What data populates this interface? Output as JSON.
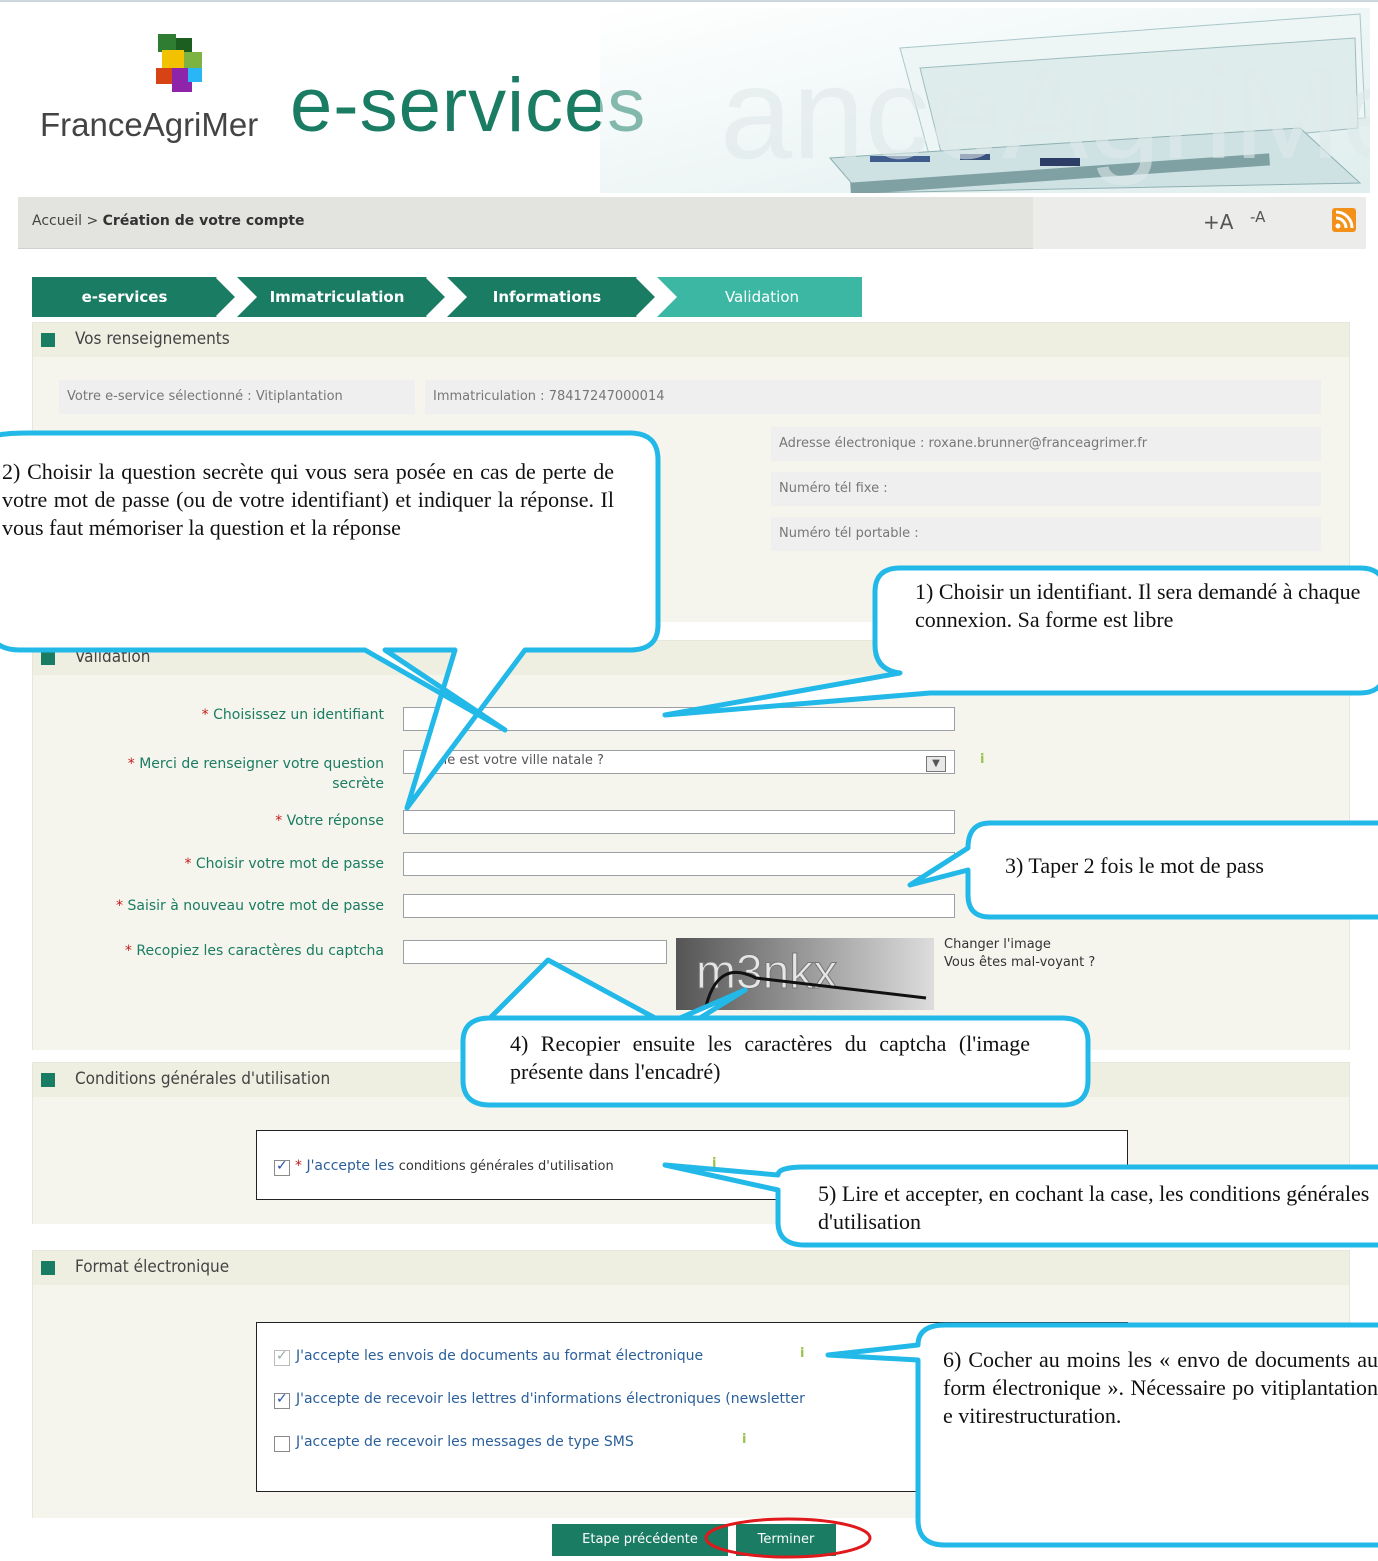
{
  "header": {
    "logo_text": "FranceAgriMer",
    "title": "e-services"
  },
  "breadcrumb": {
    "home": "Accueil",
    "separator": " > ",
    "current": "Création de votre compte",
    "font_plus": "+A",
    "font_minus": "-A",
    "rss_icon": "rss-icon"
  },
  "steps": [
    "e-services",
    "Immatriculation",
    "Informations",
    "Validation"
  ],
  "renseignements": {
    "title": "Vos renseignements",
    "service": "Votre e-service sélectionné : Vitiplantation",
    "immatriculation": "Immatriculation : 78417247000014",
    "email": "Adresse électronique : roxane.brunner@franceagrimer.fr",
    "tel_fixe": "Numéro tél fixe :",
    "tel_portable": "Numéro tél portable :"
  },
  "validation": {
    "title": "Validation",
    "required_mark": "*",
    "identifiant_label": "Choisissez un identifiant",
    "question_label_1": "Merci de renseigner votre question",
    "question_label_2": "secrète",
    "question_value": "elle est votre ville natale ?",
    "reponse_label": "Votre réponse",
    "password_label": "Choisir votre mot de passe",
    "password_confirm_label": "Saisir à nouveau votre mot de passe",
    "captcha_label": "Recopiez les caractères du captcha",
    "captcha_text": "m3nkx",
    "change_image": "Changer l'image",
    "visually_impaired": "Vous êtes mal-voyant ?"
  },
  "cgu": {
    "title": "Conditions générales d'utilisation",
    "accept_prefix": "J'accepte les ",
    "accept_link": "conditions générales d'utilisation",
    "checked": true
  },
  "format": {
    "title": "Format électronique",
    "options": [
      {
        "label": "J'accepte les envois de documents au format électronique",
        "checked": true,
        "disabled": true
      },
      {
        "label": "J'accepte de recevoir les lettres d'informations électroniques (newsletter",
        "checked": true,
        "disabled": false
      },
      {
        "label": "J'accepte de recevoir les messages de type SMS",
        "checked": false,
        "disabled": false
      }
    ]
  },
  "buttons": {
    "previous": "Etape précédente",
    "finish": "Terminer"
  },
  "callouts": {
    "c1": "1) Choisir un identifiant. Il sera demandé à chaque connexion. Sa forme est libre",
    "c2": "2) Choisir la question secrète qui vous sera posée en cas de perte de votre mot de passe (ou de votre identifiant) et indiquer la réponse. Il vous faut mémoriser la question et la réponse",
    "c3": "3) Taper 2 fois le mot de pass",
    "c4": "4) Recopier ensuite les caractères du captcha (l'image présente dans l'encadré)",
    "c5": "5) Lire et accepter, en cochant la case, les conditions générales d'utilisation",
    "c6": "6) Cocher au moins les « envo de documents au form électronique ». Nécessaire po vitiplantation e vitirestructuration."
  },
  "colors": {
    "brand_green": "#1a7c63",
    "step_active": "#3bb7a3",
    "callout_border": "#22b8e8",
    "highlight_red": "#e0191c",
    "required_red": "#c41a1a"
  }
}
